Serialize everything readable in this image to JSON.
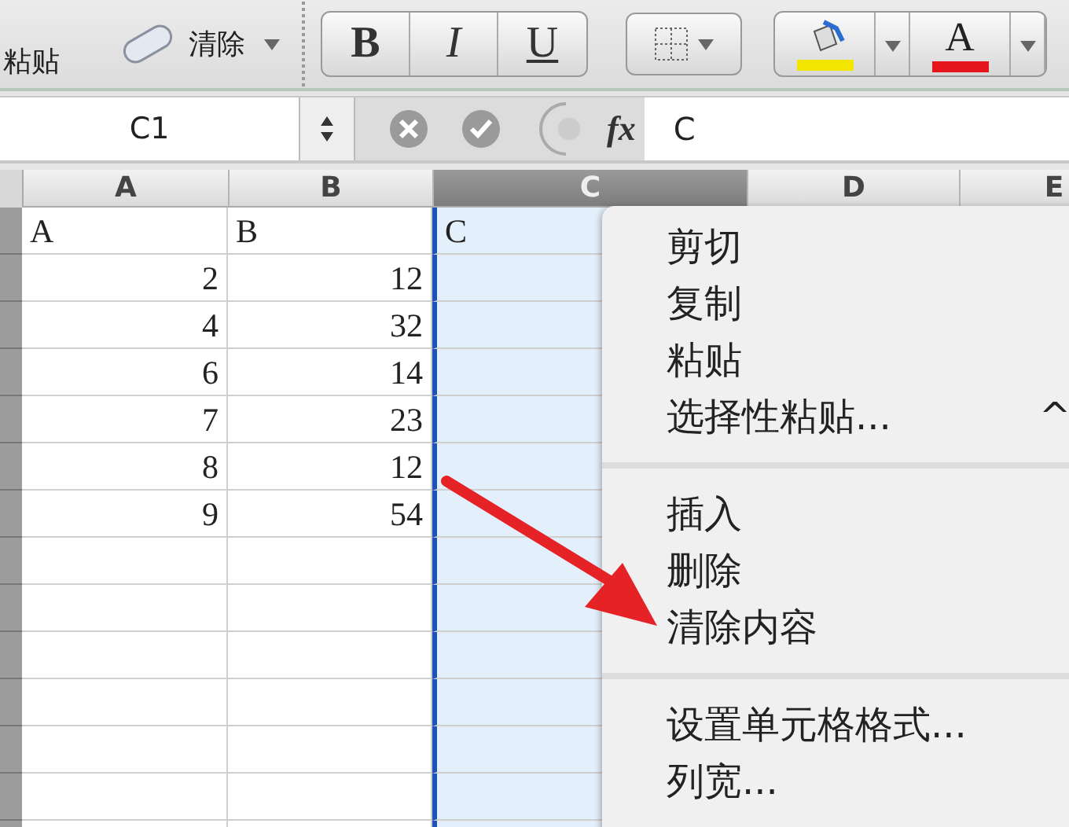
{
  "toolbar": {
    "paste_label": "粘贴",
    "clear_label": "清除",
    "format_buttons": [
      "B",
      "I",
      "U"
    ],
    "color_buttons": [
      {
        "kind": "fill",
        "color": "#f2e600"
      },
      {
        "kind": "font",
        "label": "A",
        "color": "#e5151d"
      }
    ]
  },
  "formula_bar": {
    "name_box": "C1",
    "fx": "fx",
    "value": "C"
  },
  "columns": [
    {
      "label": "A",
      "selected": false
    },
    {
      "label": "B",
      "selected": false
    },
    {
      "label": "C",
      "selected": true
    },
    {
      "label": "D",
      "selected": false
    },
    {
      "label": "E",
      "selected": false
    }
  ],
  "rows": [
    [
      "A",
      "B",
      "C"
    ],
    [
      "2",
      "12",
      ""
    ],
    [
      "4",
      "32",
      ""
    ],
    [
      "6",
      "14",
      ""
    ],
    [
      "7",
      "23",
      ""
    ],
    [
      "8",
      "12",
      ""
    ],
    [
      "9",
      "54",
      ""
    ]
  ],
  "context_menu": {
    "groups": [
      [
        {
          "label": "剪切"
        },
        {
          "label": "复制"
        },
        {
          "label": "粘贴"
        },
        {
          "label": "选择性粘贴...",
          "shortcut": "^"
        }
      ],
      [
        {
          "label": "插入"
        },
        {
          "label": "删除"
        },
        {
          "label": "清除内容"
        }
      ],
      [
        {
          "label": "设置单元格格式..."
        },
        {
          "label": "列宽..."
        }
      ]
    ]
  }
}
